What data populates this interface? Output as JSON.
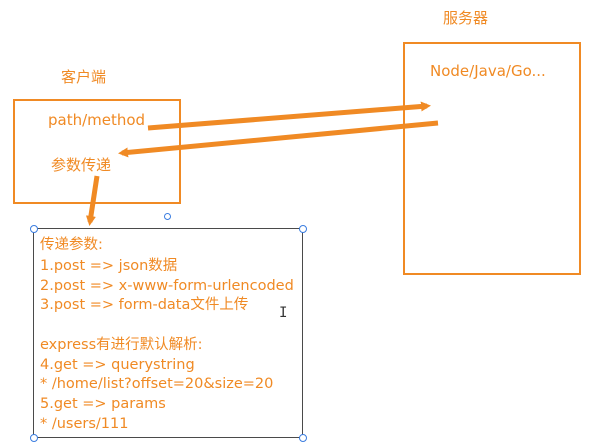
{
  "server": {
    "title": "服务器",
    "tech": "Node/Java/Go..."
  },
  "client": {
    "title": "客户端",
    "path": "path/method",
    "params": "参数传递"
  },
  "note": {
    "lines": [
      "传递参数:",
      "1.post => json数据",
      "2.post => x-www-form-urlencoded",
      "3.post => form-data文件上传",
      "",
      "express有进行默认解析:",
      "4.get => querystring",
      "* /home/list?offset=20&size=20",
      "5.get => params",
      "* /users/111"
    ]
  },
  "colors": {
    "accent": "#f08a24",
    "selection": "#3b7de0"
  },
  "icons": {
    "cursor": "text-cursor-icon"
  }
}
